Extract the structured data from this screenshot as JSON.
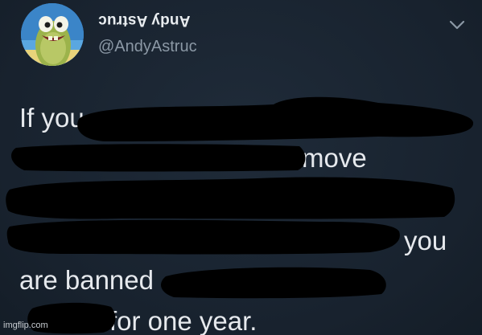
{
  "tweet": {
    "display_name": "Andy Astruc",
    "handle": "@AndyAstruc",
    "menu_icon": "chevron-down-icon",
    "avatar_icon": "cartoon-fish-avatar",
    "body_lines": {
      "line1": "If you",
      "line2": "move",
      "line4": "you",
      "line5": "are banned",
      "line6": "for one year."
    }
  },
  "watermark": "imgflip.com",
  "colors": {
    "background": "#18222e",
    "text": "#e6e9ed",
    "handle": "#8b98a5",
    "redaction": "#000000"
  }
}
